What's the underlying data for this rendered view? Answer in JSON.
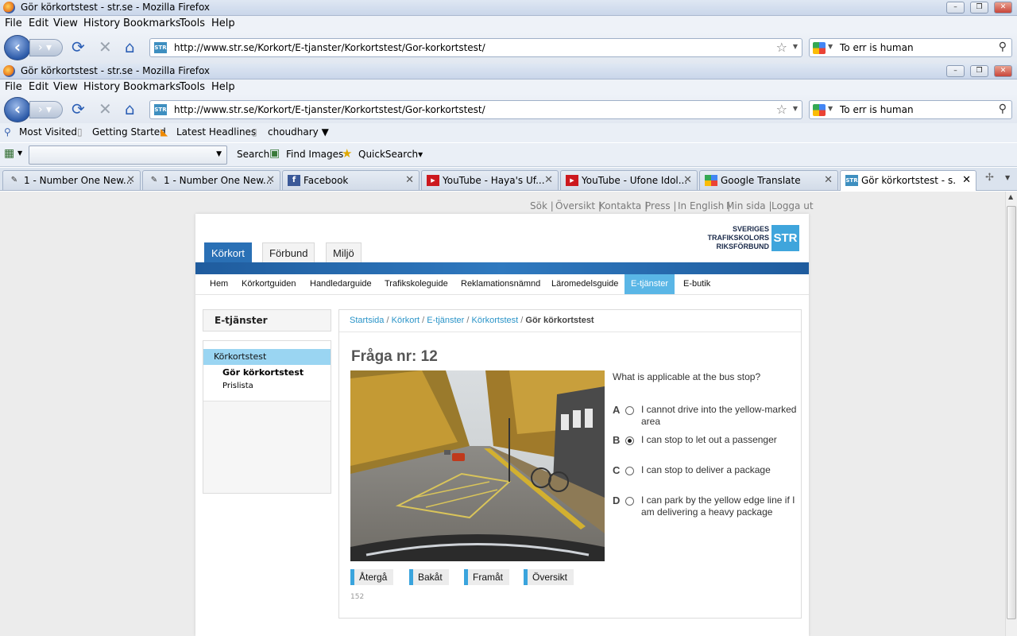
{
  "browser": {
    "title": "Gör körkortstest - str.se - Mozilla Firefox",
    "menu": [
      "File",
      "Edit",
      "View",
      "History",
      "Bookmarks",
      "Tools",
      "Help"
    ],
    "url": "http://www.str.se/Korkort/E-tjanster/Korkortstest/Gor-korkortstest/",
    "search_text": "To err is human",
    "site_icon": "STR",
    "bookmarks": [
      "Most Visited",
      "Getting Started",
      "Latest Headlines",
      "choudhary ▼"
    ],
    "toolbar2": {
      "search": "Search",
      "find_images": "Find Images",
      "quicksearch": "QuickSearch▾"
    },
    "tabs": [
      {
        "label": "1 - Number One New...",
        "icon": "swirl-icon"
      },
      {
        "label": "1 - Number One New...",
        "icon": "swirl-icon"
      },
      {
        "label": "Facebook",
        "icon": "facebook-icon"
      },
      {
        "label": "YouTube - Haya's Uf...",
        "icon": "youtube-icon"
      },
      {
        "label": "YouTube - Ufone Idol...",
        "icon": "youtube-icon"
      },
      {
        "label": "Google Translate",
        "icon": "google-icon"
      },
      {
        "label": "Gör körkortstest - s...",
        "icon": "str-icon"
      }
    ],
    "colors": {
      "accent": "#2a70b5",
      "light_accent": "#5ab6e6"
    }
  },
  "site": {
    "util_links": [
      "Sök |",
      "Översikt |",
      "Kontakta |",
      "Press |",
      "In English |",
      "Min sida |",
      "Logga ut"
    ],
    "logo": {
      "line1": "SVERIGES",
      "line2": "TRAFIKSKOLORS",
      "line3": "RIKSFÖRBUND",
      "mark": "STR"
    },
    "main_tabs": [
      "Körkort",
      "Förbund",
      "Miljö"
    ],
    "subnav": [
      "Hem",
      "Körkortguiden",
      "Handledarguide",
      "Trafikskoleguide",
      "Reklamationsnämnd",
      "Läromedelsguide",
      "E-tjänster",
      "E-butik"
    ],
    "sidebar": {
      "title": "E-tjänster",
      "section": "Körkortstest",
      "items": [
        "Gör körkortstest",
        "Prislista"
      ]
    },
    "breadcrumb": {
      "items": [
        "Startsida",
        "Körkort",
        "E-tjänster",
        "Körkortstest"
      ],
      "current": "Gör körkortstest",
      "sep": "/"
    },
    "question": {
      "title": "Fråga nr: 12",
      "text": "What is applicable at the bus stop?",
      "options": [
        {
          "letter": "A",
          "text": "I cannot drive into the yellow-marked area",
          "selected": false
        },
        {
          "letter": "B",
          "text": "I can stop to let out a passenger",
          "selected": true
        },
        {
          "letter": "C",
          "text": "I can stop to deliver a package",
          "selected": false
        },
        {
          "letter": "D",
          "text": "I can park by the yellow edge line if I am delivering a heavy package",
          "selected": false
        }
      ]
    },
    "buttons": [
      "Återgå",
      "Bakåt",
      "Framåt",
      "Översikt"
    ],
    "footer_code": "152"
  }
}
